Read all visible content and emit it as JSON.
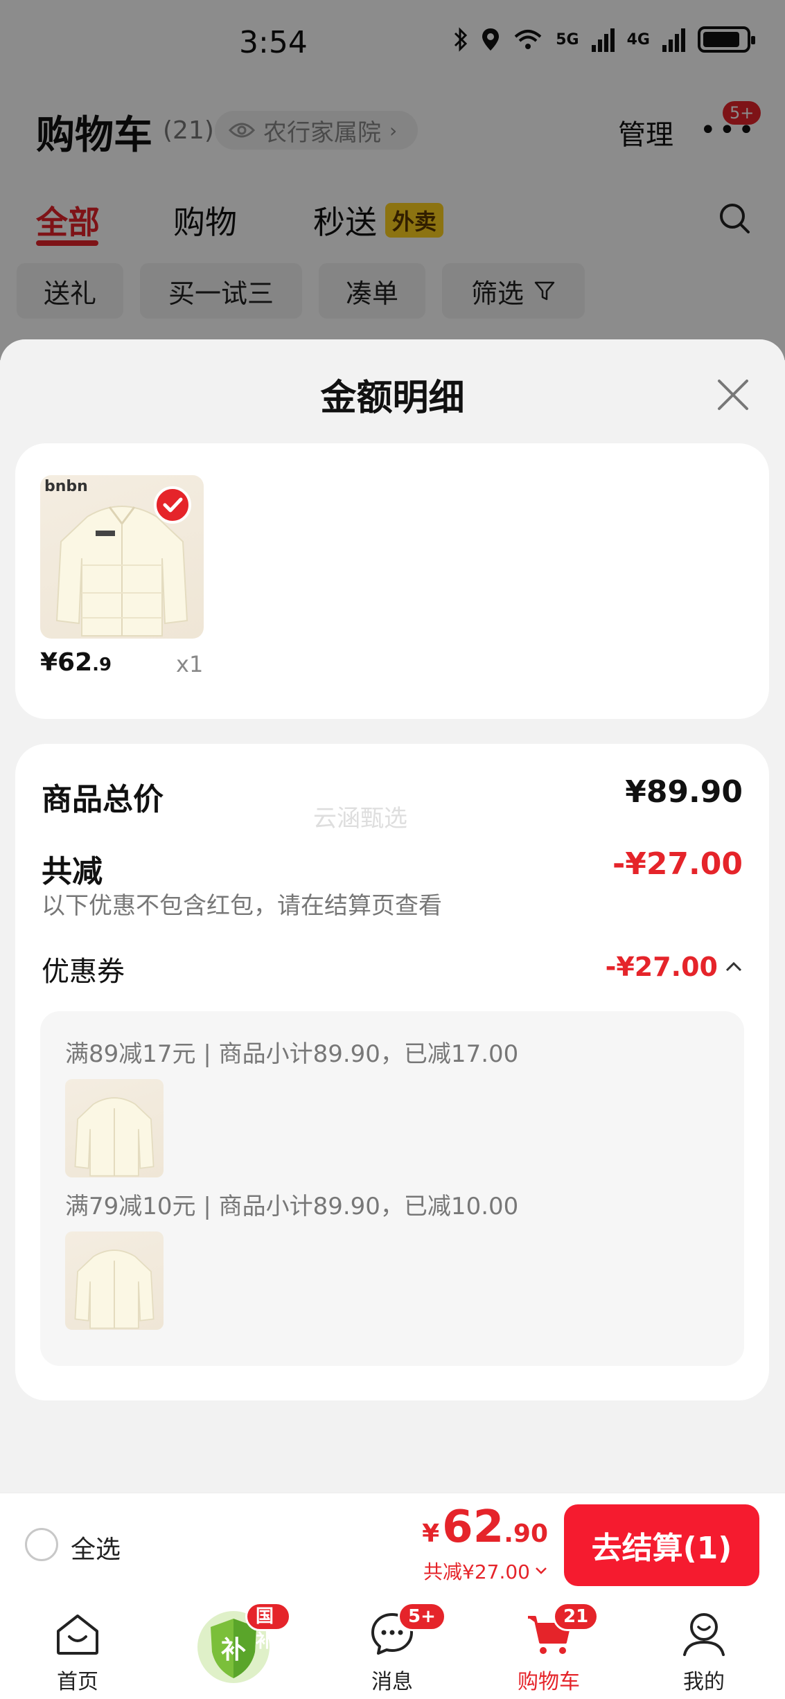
{
  "status_bar": {
    "time": "3:54",
    "net1": "5G",
    "net2": "4G"
  },
  "header": {
    "title": "购物车",
    "count": "(21)",
    "address": "农行家属院",
    "manage": "管理",
    "more_badge": "5+"
  },
  "tabs": [
    {
      "label": "全部",
      "active": true
    },
    {
      "label": "购物",
      "active": false
    },
    {
      "label": "秒送",
      "active": false,
      "tag": "外卖"
    }
  ],
  "chips": [
    {
      "label": "送礼"
    },
    {
      "label": "买一试三"
    },
    {
      "label": "凑单"
    },
    {
      "label": "筛选"
    }
  ],
  "sheet": {
    "title": "金额明细",
    "product": {
      "brand": "bnbn",
      "price_int": "¥62",
      "price_dec": ".9",
      "qty": "x1"
    },
    "detail": {
      "watermark": "云涵甄选",
      "goods_total_label": "商品总价",
      "goods_total_value": "¥89.90",
      "discount_label": "共减",
      "discount_value": "-¥27.00",
      "discount_note": "以下优惠不包含红包，请在结算页查看",
      "coupon_label": "优惠券",
      "coupon_value": "-¥27.00",
      "coupons": [
        {
          "text": "满89减17元 | 商品小计89.90，已减17.00"
        },
        {
          "text": "满79减10元 | 商品小计89.90，已减10.00"
        }
      ]
    }
  },
  "checkout": {
    "select_all": "全选",
    "currency": "¥",
    "total_int": "62",
    "total_dec": ".90",
    "saved": "共减¥27.00",
    "button": "去结算(1)"
  },
  "bottom_nav": [
    {
      "label": "首页",
      "icon": "home-icon"
    },
    {
      "label": "",
      "icon": "subsidy-shield-icon",
      "badge": "国补",
      "glyph": "补"
    },
    {
      "label": "消息",
      "icon": "message-icon",
      "badge": "5+"
    },
    {
      "label": "购物车",
      "icon": "cart-icon",
      "badge": "21",
      "active": true
    },
    {
      "label": "我的",
      "icon": "profile-icon"
    }
  ],
  "colors": {
    "accent": "#e5242a",
    "checkout_button": "#f51b2f",
    "takeout_tag": "#ffd21f"
  }
}
